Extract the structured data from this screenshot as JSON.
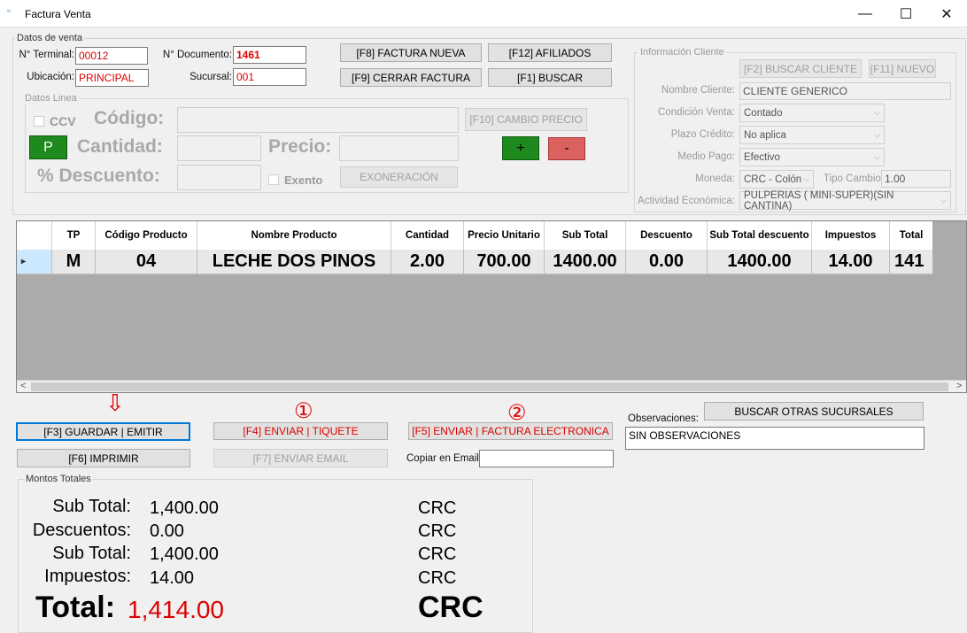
{
  "window": {
    "title": "Factura Venta",
    "minimize": "—",
    "maximize": "☐",
    "close": "✕"
  },
  "datos_venta": {
    "legend": "Datos de venta",
    "terminal_label": "N° Terminal:",
    "terminal_value": "00012",
    "documento_label": "N° Documento:",
    "documento_value": "1461",
    "ubicacion_label": "Ubicación:",
    "ubicacion_value": "PRINCIPAL",
    "sucursal_label": "Sucursal:",
    "sucursal_value": "001"
  },
  "buttons_top": {
    "factura_nueva": "[F8] FACTURA NUEVA",
    "afiliados": "[F12] AFILIADOS",
    "cerrar_factura": "[F9] CERRAR FACTURA",
    "buscar": "[F1] BUSCAR"
  },
  "datos_linea": {
    "legend": "Datos Linea",
    "ccv_label": "CCV",
    "codigo_label": "Código:",
    "cambio_precio": "[F10] CAMBIO PRECIO",
    "p_button": "P",
    "cantidad_label": "Cantidad:",
    "precio_label": "Precio:",
    "plus": "+",
    "minus": "-",
    "descuento_label": "% Descuento:",
    "exento_label": "Exento",
    "exoneracion": "EXONERACIÓN"
  },
  "cliente": {
    "legend": "Información Cliente",
    "buscar_cliente": "[F2] BUSCAR CLIENTE",
    "nuevo": "[F11] NUEVO",
    "nombre_label": "Nombre Cliente:",
    "nombre_value": "CLIENTE GENERICO",
    "condicion_label": "Condición Venta:",
    "condicion_value": "Contado",
    "plazo_label": "Plazo Crédito:",
    "plazo_value": "No aplica",
    "medio_label": "Medio Pago:",
    "medio_value": "Efectivo",
    "moneda_label": "Moneda:",
    "moneda_value": "CRC - Colón",
    "tipo_cambio_label": "Tipo Cambio:",
    "tipo_cambio_value": "1.00",
    "actividad_label": "Actividad Económica:",
    "actividad_value": "PULPERIAS ( MINI-SUPER)(SIN CANTINA)"
  },
  "table": {
    "headers": [
      "TP",
      "Código Producto",
      "Nombre Producto",
      "Cantidad",
      "Precio Unitario",
      "Sub Total",
      "Descuento",
      "Sub Total descuento",
      "Impuestos",
      "Total"
    ],
    "rows": [
      [
        "M",
        "04",
        "LECHE DOS PINOS",
        "2.00",
        "700.00",
        "1400.00",
        "0.00",
        "1400.00",
        "14.00",
        "141"
      ]
    ],
    "row_marker": "▸",
    "scroll_left": "<",
    "scroll_right": ">"
  },
  "actions": {
    "guardar": "[F3] GUARDAR | EMITIR",
    "enviar_tiquete": "[F4] ENVIAR | TIQUETE",
    "enviar_factura": "[F5] ENVIAR | FACTURA ELECTRONICA",
    "imprimir": "[F6] IMPRIMIR",
    "enviar_email": "[F7] ENVIAR EMAIL",
    "copiar_email_label": "Copiar en Email:",
    "copiar_email_value": "",
    "buscar_sucursales": "BUSCAR OTRAS SUCURSALES",
    "observaciones_label": "Observaciones:",
    "observaciones_value": "SIN OBSERVACIONES",
    "marker_1": "①",
    "marker_2": "②",
    "arrow": "⇩"
  },
  "totales": {
    "legend": "Montos Totales",
    "subtotal_label": "Sub Total:",
    "subtotal_value": "1,400.00",
    "subtotal_cur": "CRC",
    "descuentos_label": "Descuentos:",
    "descuentos_value": "0.00",
    "descuentos_cur": "CRC",
    "subtotal2_label": "Sub Total:",
    "subtotal2_value": "1,400.00",
    "subtotal2_cur": "CRC",
    "impuestos_label": "Impuestos:",
    "impuestos_value": "14.00",
    "impuestos_cur": "CRC",
    "total_label": "Total:",
    "total_value": "1,414.00",
    "total_cur": "CRC"
  },
  "colors": {
    "accent_red": "#dd0000",
    "green": "#1e8a1e",
    "salmon": "#d9625f",
    "focus_blue": "#0078d7"
  }
}
